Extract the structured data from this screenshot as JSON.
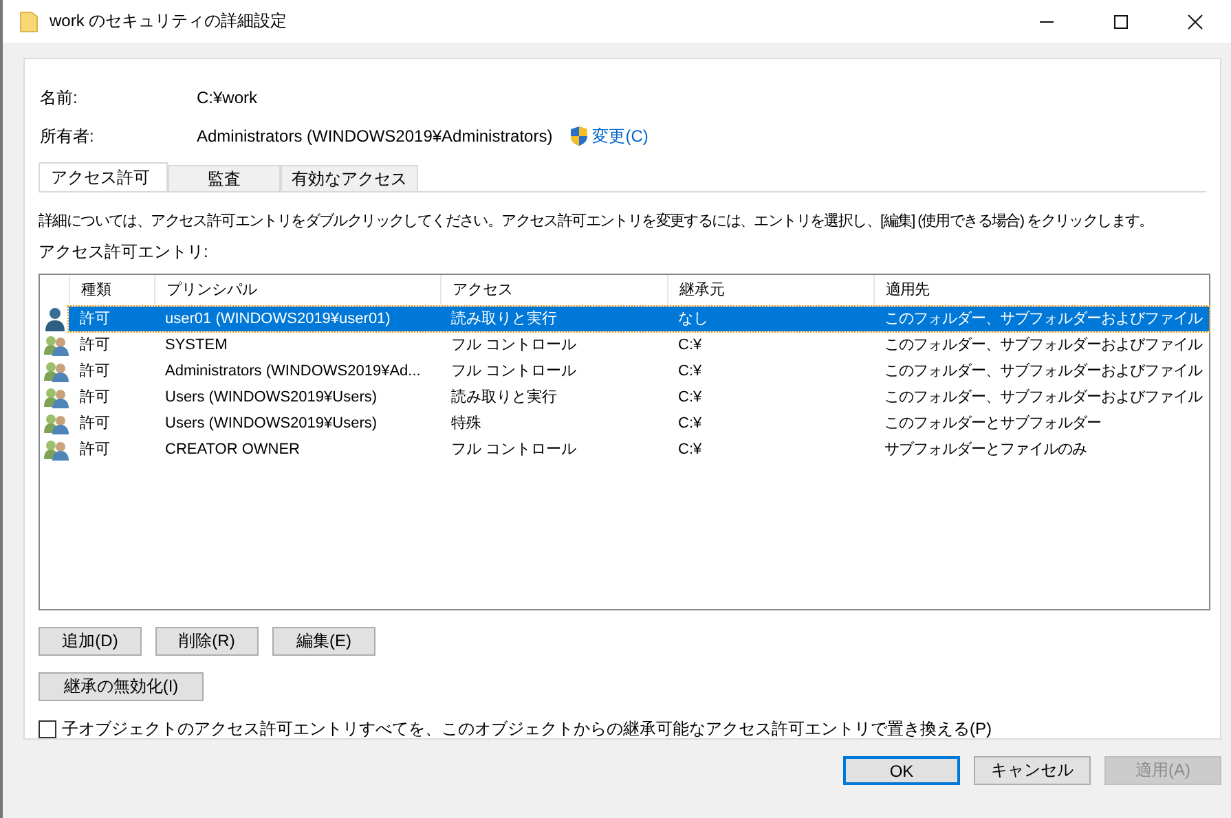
{
  "window": {
    "title": "work のセキュリティの詳細設定"
  },
  "info": [
    {
      "label": "名前:",
      "value": "C:¥work"
    },
    {
      "label": "所有者:",
      "value": "Administrators (WINDOWS2019¥Administrators)",
      "link": "変更(C)"
    }
  ],
  "tabs": [
    {
      "label": "アクセス許可",
      "selected": true
    },
    {
      "label": "監査",
      "selected": false
    },
    {
      "label": "有効なアクセス",
      "selected": false
    }
  ],
  "description": "詳細については、アクセス許可エントリをダブルクリックしてください。アクセス許可エントリを変更するには、エントリを選択し、[編集] (使用できる場合) をクリックします。",
  "list_label": "アクセス許可エントリ:",
  "table": {
    "columns": [
      "種類",
      "プリンシパル",
      "アクセス",
      "継承元",
      "適用先"
    ],
    "rows": [
      {
        "kind": "user",
        "selected": true,
        "cells": [
          "許可",
          "user01 (WINDOWS2019¥user01)",
          "読み取りと実行",
          "なし",
          "このフォルダー、サブフォルダーおよびファイル"
        ]
      },
      {
        "kind": "group",
        "selected": false,
        "cells": [
          "許可",
          "SYSTEM",
          "フル コントロール",
          "C:¥",
          "このフォルダー、サブフォルダーおよびファイル"
        ]
      },
      {
        "kind": "group",
        "selected": false,
        "cells": [
          "許可",
          "Administrators (WINDOWS2019¥Ad...",
          "フル コントロール",
          "C:¥",
          "このフォルダー、サブフォルダーおよびファイル"
        ]
      },
      {
        "kind": "group",
        "selected": false,
        "cells": [
          "許可",
          "Users (WINDOWS2019¥Users)",
          "読み取りと実行",
          "C:¥",
          "このフォルダー、サブフォルダーおよびファイル"
        ]
      },
      {
        "kind": "group",
        "selected": false,
        "cells": [
          "許可",
          "Users (WINDOWS2019¥Users)",
          "特殊",
          "C:¥",
          "このフォルダーとサブフォルダー"
        ]
      },
      {
        "kind": "group",
        "selected": false,
        "cells": [
          "許可",
          "CREATOR OWNER",
          "フル コントロール",
          "C:¥",
          "サブフォルダーとファイルのみ"
        ]
      }
    ]
  },
  "entry_buttons": [
    "追加(D)",
    "削除(R)",
    "編集(E)"
  ],
  "inherit_button": "継承の無効化(I)",
  "replace_checkbox": {
    "label": "子オブジェクトのアクセス許可エントリすべてを、このオブジェクトからの継承可能なアクセス許可エントリで置き換える(P)",
    "checked": false
  },
  "footer_buttons": [
    {
      "label": "OK",
      "default": true,
      "disabled": false
    },
    {
      "label": "キャンセル",
      "default": false,
      "disabled": false
    },
    {
      "label": "適用(A)",
      "default": false,
      "disabled": true
    }
  ]
}
